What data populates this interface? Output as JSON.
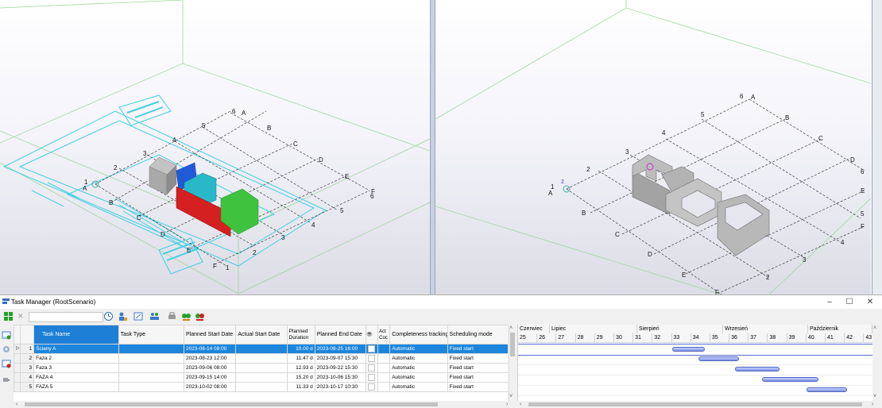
{
  "window": {
    "title": "Task Manager (RootScenario)",
    "minimize": "–",
    "maximize": "☐",
    "close": "✕"
  },
  "toolbar": {
    "clear_icon": "✕",
    "icons": [
      "grid-icon",
      "clock-icon",
      "person-icon",
      "chart-icon",
      "team-icon",
      "print-icon",
      "link-icon",
      "unlink-icon"
    ]
  },
  "viewports": {
    "left_labels_numbers": [
      "1",
      "2",
      "3",
      "4",
      "5",
      "6",
      "1",
      "2",
      "3",
      "4",
      "5",
      "6"
    ],
    "left_labels_letters": [
      "A",
      "B",
      "C",
      "D",
      "E",
      "F",
      "A",
      "B",
      "C",
      "D",
      "E",
      "F"
    ],
    "axis_z": "z",
    "right_labels_numbers": [
      "1",
      "2",
      "3",
      "4",
      "5",
      "6",
      "2",
      "3",
      "4",
      "5",
      "6"
    ],
    "right_labels_letters": [
      "A",
      "B",
      "C",
      "D",
      "E",
      "F",
      "A",
      "B",
      "C",
      "D",
      "E",
      "F"
    ]
  },
  "table": {
    "headers": {
      "task_name": "Task Name",
      "task_type": "Task Type",
      "planned_start": "Planned Start Date",
      "actual_start": "Actual Start Date",
      "planned_duration_1": "Planned",
      "planned_duration_2": "Duration",
      "planned_end": "Planned End Date",
      "icon_col": "👁",
      "act_1": "Act",
      "act_2": "Coc",
      "completeness": "Completeness tracking",
      "scheduling": "Scheduling mode"
    },
    "rows": [
      {
        "n": "1",
        "name": "Ściany A",
        "type": "",
        "start": "2023-08-14 08:00",
        "actual": "",
        "duration": "10.00 d",
        "end": "2023-08-25 16:00",
        "tracking": "Automatic",
        "mode": "Fixed start"
      },
      {
        "n": "2",
        "name": "Faza 2",
        "type": "",
        "start": "2023-08-23 12:00",
        "actual": "",
        "duration": "11.47 d",
        "end": "2023-09-07 15:30",
        "tracking": "Automatic",
        "mode": "Fixed start"
      },
      {
        "n": "3",
        "name": "Faza 3",
        "type": "",
        "start": "2023-09-06 08:00",
        "actual": "",
        "duration": "12.93 d",
        "end": "2023-09-22 15:30",
        "tracking": "Automatic",
        "mode": "Fixed start"
      },
      {
        "n": "4",
        "name": "FAZA 4",
        "type": "",
        "start": "2023-09-15 14:00",
        "actual": "",
        "duration": "15.20 d",
        "end": "2023-10-06 15:30",
        "tracking": "Automatic",
        "mode": "Fixed start"
      },
      {
        "n": "5",
        "name": "FAZA 5",
        "type": "",
        "start": "2023-10-02 08:00",
        "actual": "",
        "duration": "11.33 d",
        "end": "2023-10-17 10:30",
        "tracking": "Automatic",
        "mode": "Fixed start"
      }
    ]
  },
  "gantt": {
    "months": [
      "Czerwiec",
      "Lipiec",
      "Sierpień",
      "Wrzesień",
      "Październik"
    ],
    "weeks": [
      "25",
      "26",
      "27",
      "28",
      "29",
      "30",
      "31",
      "32",
      "33",
      "34",
      "35",
      "36",
      "37",
      "38",
      "39",
      "40",
      "41",
      "42",
      "43"
    ],
    "bars": [
      {
        "task": "Ściany A",
        "start_week": 33.0,
        "end_week": 34.7
      },
      {
        "task": "Faza 2",
        "start_week": 34.4,
        "end_week": 36.5
      },
      {
        "task": "Faza 3",
        "start_week": 36.3,
        "end_week": 38.6
      },
      {
        "task": "FAZA 4",
        "start_week": 37.7,
        "end_week": 40.6
      },
      {
        "task": "FAZA 5",
        "start_week": 40.0,
        "end_week": 42.1
      }
    ]
  },
  "colors": {
    "selection": "#1c86dd",
    "walls_gray": "#a9a9a9",
    "walls_blue": "#1f5ad8",
    "walls_cyan": "#28b8c8",
    "walls_red": "#d42020",
    "walls_green": "#3fc33f",
    "plan_cyan": "#3fd0e0"
  }
}
